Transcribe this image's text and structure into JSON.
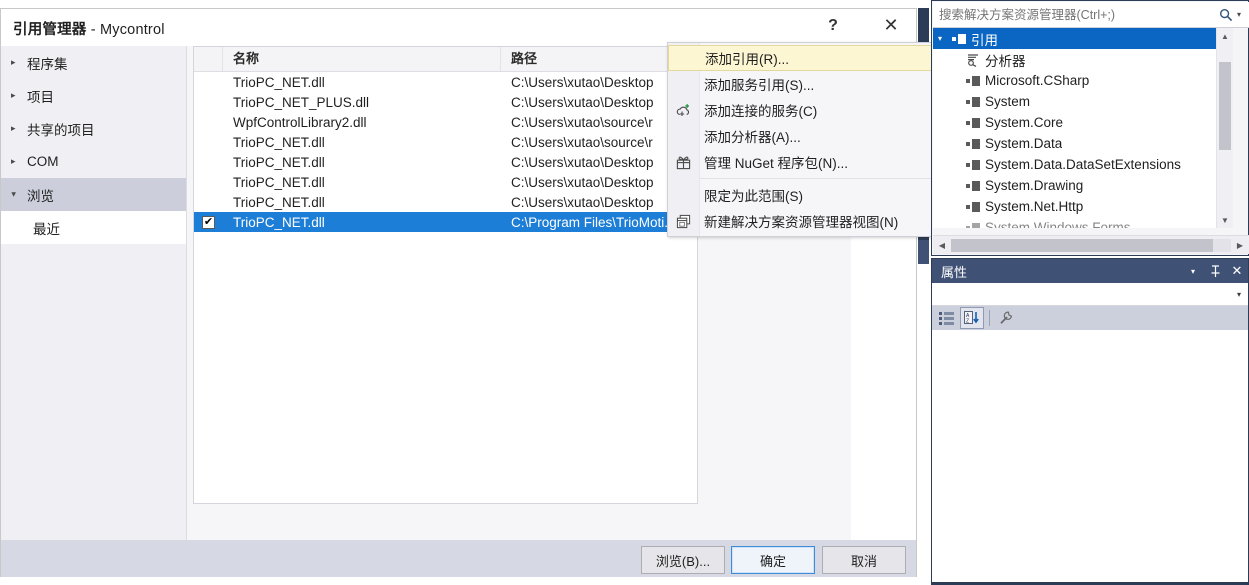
{
  "dialog": {
    "title_main": "引用管理器",
    "title_sep": " - ",
    "title_project": "Mycontrol",
    "help_label": "?",
    "close_label": "✕",
    "tree": [
      {
        "label": "程序集",
        "expanded": false,
        "selected": false,
        "child": false
      },
      {
        "label": "项目",
        "expanded": false,
        "selected": false,
        "child": false
      },
      {
        "label": "共享的项目",
        "expanded": false,
        "selected": false,
        "child": false
      },
      {
        "label": "COM",
        "expanded": false,
        "selected": false,
        "child": false
      },
      {
        "label": "浏览",
        "expanded": true,
        "selected": true,
        "child": false
      },
      {
        "label": "最近",
        "expanded": false,
        "selected": false,
        "child": true
      }
    ],
    "list": {
      "headers": {
        "name": "名称",
        "path": "路径"
      },
      "rows": [
        {
          "checked": false,
          "name": "TrioPC_NET.dll",
          "path": "C:\\Users\\xutao\\Desktop",
          "selected": false
        },
        {
          "checked": false,
          "name": "TrioPC_NET_PLUS.dll",
          "path": "C:\\Users\\xutao\\Desktop",
          "selected": false
        },
        {
          "checked": false,
          "name": "WpfControlLibrary2.dll",
          "path": "C:\\Users\\xutao\\source\\r",
          "selected": false
        },
        {
          "checked": false,
          "name": "TrioPC_NET.dll",
          "path": "C:\\Users\\xutao\\source\\r",
          "selected": false
        },
        {
          "checked": false,
          "name": "TrioPC_NET.dll",
          "path": "C:\\Users\\xutao\\Desktop",
          "selected": false
        },
        {
          "checked": false,
          "name": "TrioPC_NET.dll",
          "path": "C:\\Users\\xutao\\Desktop",
          "selected": false
        },
        {
          "checked": false,
          "name": "TrioPC_NET.dll",
          "path": "C:\\Users\\xutao\\Desktop",
          "selected": false
        },
        {
          "checked": true,
          "name": "TrioPC_NET.dll",
          "path": "C:\\Program Files\\TrioMoti...",
          "selected": true
        }
      ],
      "check_glyph": "✔"
    },
    "footer": {
      "browse_label": "浏览(B)...",
      "ok_label": "确定",
      "cancel_label": "取消"
    }
  },
  "context_menu": {
    "items": [
      {
        "label": "添加引用(R)...",
        "icon": "",
        "icon_name": "none-icon",
        "highlighted": true,
        "separator_after": false
      },
      {
        "label": "添加服务引用(S)...",
        "icon": "",
        "icon_name": "none-icon",
        "highlighted": false,
        "separator_after": false
      },
      {
        "label": "添加连接的服务(C)",
        "icon": "☁",
        "icon_name": "cloud-plus-icon",
        "highlighted": false,
        "separator_after": false
      },
      {
        "label": "添加分析器(A)...",
        "icon": "",
        "icon_name": "none-icon",
        "highlighted": false,
        "separator_after": false
      },
      {
        "label": "管理 NuGet 程序包(N)...",
        "icon": "🎁",
        "icon_name": "nuget-gift-icon",
        "highlighted": false,
        "separator_after": true
      },
      {
        "label": "限定为此范围(S)",
        "icon": "",
        "icon_name": "none-icon",
        "highlighted": false,
        "separator_after": false
      },
      {
        "label": "新建解决方案资源管理器视图(N)",
        "icon": "❐",
        "icon_name": "new-window-icon",
        "highlighted": false,
        "separator_after": false
      }
    ]
  },
  "solution_explorer": {
    "search_placeholder": "搜索解决方案资源管理器(Ctrl+;)",
    "search_value": "",
    "search_icon": "search-icon",
    "tree": [
      {
        "label": "引用",
        "indent": 0,
        "selected": true,
        "expander": "▾",
        "icon": "reference-icon"
      },
      {
        "label": "分析器",
        "indent": 1,
        "selected": false,
        "expander": "",
        "icon": "analyzer-icon"
      },
      {
        "label": "Microsoft.CSharp",
        "indent": 1,
        "selected": false,
        "expander": "",
        "icon": "reference-icon"
      },
      {
        "label": "System",
        "indent": 1,
        "selected": false,
        "expander": "",
        "icon": "reference-icon"
      },
      {
        "label": "System.Core",
        "indent": 1,
        "selected": false,
        "expander": "",
        "icon": "reference-icon"
      },
      {
        "label": "System.Data",
        "indent": 1,
        "selected": false,
        "expander": "",
        "icon": "reference-icon"
      },
      {
        "label": "System.Data.DataSetExtensions",
        "indent": 1,
        "selected": false,
        "expander": "",
        "icon": "reference-icon"
      },
      {
        "label": "System.Drawing",
        "indent": 1,
        "selected": false,
        "expander": "",
        "icon": "reference-icon"
      },
      {
        "label": "System.Net.Http",
        "indent": 1,
        "selected": false,
        "expander": "",
        "icon": "reference-icon"
      },
      {
        "label": "System.Windows.Forms",
        "indent": 1,
        "selected": false,
        "expander": "",
        "icon": "reference-icon"
      }
    ],
    "scroll_up": "▲",
    "scroll_down": "▼",
    "scroll_left": "◀",
    "scroll_right": "▶"
  },
  "properties": {
    "title": "属性",
    "menu_caret": "▾",
    "pin_glyph": "⚲",
    "close_glyph": "✕",
    "combo_value": "",
    "combo_caret": "▾",
    "toolbar": {
      "categorized_label": "categorized-icon",
      "alphabetical_label": "alphabetical-sort-icon",
      "events_label": "properties-wrench-icon"
    }
  },
  "colors": {
    "selection_blue": "#1c7ed6",
    "tree_selection_blue": "#0a66c2",
    "menu_highlight": "#fdf6d2",
    "panel_header": "#3f5175",
    "dock_border": "#2d3c56"
  }
}
